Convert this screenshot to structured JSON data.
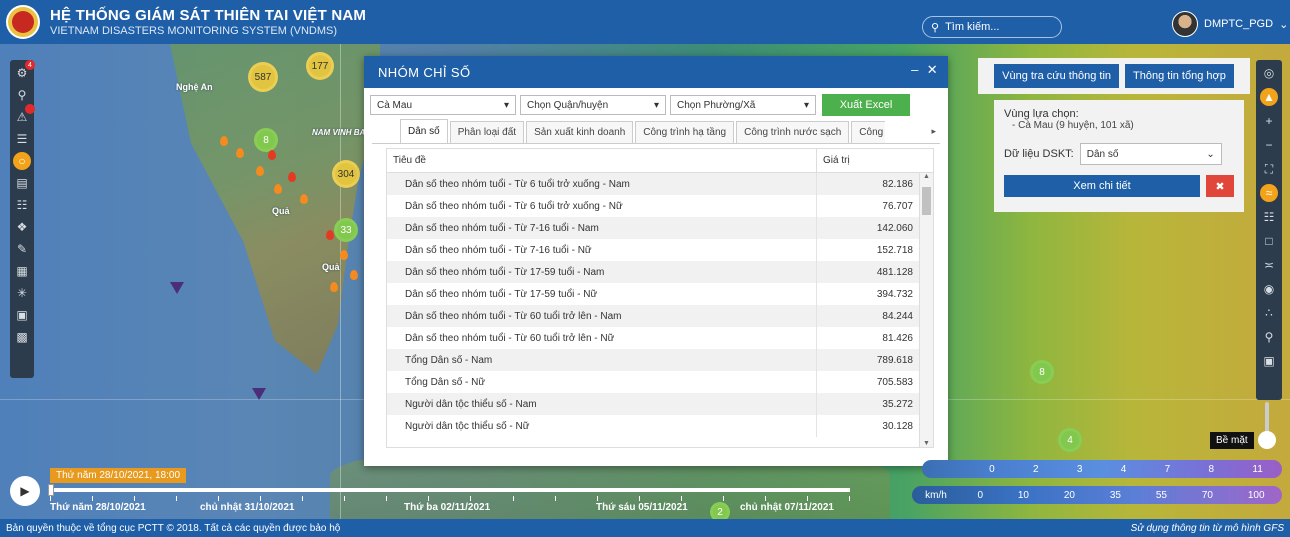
{
  "header": {
    "title": "HỆ THỐNG GIÁM SÁT THIÊN TAI VIỆT NAM",
    "subtitle": "VIETNAM DISASTERS MONITORING SYSTEM (VNDMS)",
    "search_placeholder": "Tìm kiếm...",
    "user": "DMPTC_PGD"
  },
  "left_toolbar": {
    "badge": "4"
  },
  "map": {
    "clusters": [
      "587",
      "177",
      "8",
      "304",
      "33",
      "8",
      "4",
      "2"
    ],
    "labels": [
      "Nghệ An",
      "NAM VINH BA",
      "Quả",
      "Quả"
    ]
  },
  "modal": {
    "title": "NHÓM CHỈ SỐ",
    "province": "Cà Mau",
    "district": "Chọn Quận/huyện",
    "ward": "Chọn Phường/Xã",
    "export": "Xuất Excel",
    "tabs": [
      "Dân số",
      "Phân loại đất",
      "Sản xuất kinh doanh",
      "Công trình hạ tầng",
      "Công trình nước sạch",
      "Công"
    ],
    "col_title": "Tiêu đề",
    "col_value": "Giá trị",
    "rows": [
      {
        "name": "Dân số theo nhóm tuổi - Từ 6 tuổi trở xuống - Nam",
        "value": "82.186"
      },
      {
        "name": "Dân số theo nhóm tuổi - Từ 6 tuổi trở xuống - Nữ",
        "value": "76.707"
      },
      {
        "name": "Dân số theo nhóm tuổi - Từ 7-16 tuổi - Nam",
        "value": "142.060"
      },
      {
        "name": "Dân số theo nhóm tuổi - Từ 7-16 tuổi - Nữ",
        "value": "152.718"
      },
      {
        "name": "Dân số theo nhóm tuổi - Từ 17-59 tuổi - Nam",
        "value": "481.128"
      },
      {
        "name": "Dân số theo nhóm tuổi - Từ 17-59 tuổi - Nữ",
        "value": "394.732"
      },
      {
        "name": "Dân số theo nhóm tuổi - Từ 60 tuổi trở lên - Nam",
        "value": "84.244"
      },
      {
        "name": "Dân số theo nhóm tuổi - Từ 60 tuổi trở lên - Nữ",
        "value": "81.426"
      },
      {
        "name": "Tổng Dân số - Nam",
        "value": "789.618"
      },
      {
        "name": "Tổng Dân số - Nữ",
        "value": "705.583"
      },
      {
        "name": "Người dân tộc thiểu số - Nam",
        "value": "35.272"
      },
      {
        "name": "Người dân tộc thiểu số - Nữ",
        "value": "30.128"
      }
    ]
  },
  "side_panel": {
    "btn_lookup": "Vùng tra cứu thông tin",
    "btn_summary": "Thông tin tổng hợp",
    "region_label": "Vùng lựa chọn:",
    "region_value": "- Cà Mau (9 huyện, 101 xã)",
    "dskt_label": "Dữ liệu DSKT:",
    "dskt_value": "Dân số",
    "btn_detail": "Xem chi tiết"
  },
  "legend": {
    "wind_unit": "km/h",
    "wind_values": [
      "0",
      "10",
      "20",
      "35",
      "55",
      "70",
      "100"
    ],
    "beaufort_values": [
      "0",
      "2",
      "3",
      "4",
      "7",
      "8",
      "11"
    ],
    "surface": "Bề mặt"
  },
  "timeline": {
    "current": "Thứ năm 28/10/2021, 18:00",
    "dates": [
      "Thứ năm 28/10/2021",
      "chủ nhật 31/10/2021",
      "Thứ ba 02/11/2021",
      "Thứ sáu 05/11/2021",
      "chủ nhật 07/11/2021"
    ]
  },
  "footer": {
    "copyright": "Bản quyền thuộc về tổng cục PCTT © 2018. Tất cả các quyền được bảo hộ",
    "source": "Sử dụng thông tin từ mô hình GFS"
  },
  "colors": {
    "header": "#1f5fa8",
    "excel": "#4cb04c",
    "close": "#e0463a",
    "accent": "#f3a31a"
  }
}
